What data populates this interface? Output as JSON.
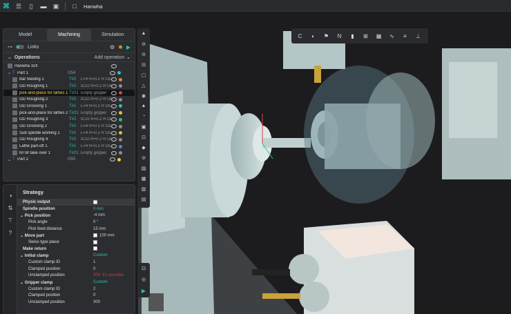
{
  "app": {
    "title": "Hanwha"
  },
  "tabs": [
    "Model",
    "Machining",
    "Simulation"
  ],
  "links": {
    "label": "Links"
  },
  "operations": {
    "header": "Operations",
    "add_label": "Add operation",
    "root_label": "Hanwha 32II",
    "part1": {
      "label": "Part 1",
      "code": "G54"
    },
    "part2": {
      "label": "Part 2",
      "code": "G55"
    },
    "rows": [
      {
        "name": "Bar feeding 1",
        "tool": "T#1",
        "tool_name": "L=4 R=0.2 R OD",
        "color": "#d98b2b"
      },
      {
        "name": "OD Roughing 1",
        "tool": "T#2",
        "tool_name": "IC10 R=0.2 R OD",
        "color": "#8f8f8f"
      },
      {
        "name": "pick-and-place for lathes 1",
        "tool": "T#21",
        "tool_name": "Empty gripper",
        "color": "#d24848"
      },
      {
        "name": "OD Roughing 2",
        "tool": "T#2",
        "tool_name": "IC10 R=0.2 R OD",
        "color": "#8f8f8f"
      },
      {
        "name": "OD Grooving 1",
        "tool": "T#1",
        "tool_name": "L=4 R=0.2 R OD",
        "color": "#27c2b0"
      },
      {
        "name": "pick-and-place for lathes 2",
        "tool": "T#21",
        "tool_name": "Empty gripper",
        "color": "#d9c52b"
      },
      {
        "name": "OD Roughing 3",
        "tool": "T#2",
        "tool_name": "IC10 R=0.2 R OD",
        "color": "#27c27a"
      },
      {
        "name": "OD Grooving 2",
        "tool": "T#1",
        "tool_name": "L=4 R=0.2 R OD",
        "color": "#8f8f8f"
      },
      {
        "name": "Sub spindle working 1",
        "tool": "T#1",
        "tool_name": "L=4 R=0.2 R OD",
        "color": "#d9c52b"
      },
      {
        "name": "OD Roughing 4",
        "tool": "T#2",
        "tool_name": "IC10 R=0.2 R OD",
        "color": "#8f8f8f"
      },
      {
        "name": "Lathe part-off 1",
        "tool": "T#1",
        "tool_name": "L=4 R=0.2 R OD",
        "color": "#3a8de0"
      },
      {
        "name": "MTM take over 1",
        "tool": "T#21",
        "tool_name": "Empty gripper",
        "color": "#8f8f8f"
      }
    ]
  },
  "strategy": {
    "title": "Strategy",
    "rows": [
      {
        "label": "Physic output",
        "value": "",
        "checkbox": true
      },
      {
        "label": "Spindle position",
        "value": "0 mm"
      },
      {
        "label": "Pick position",
        "value": "-4 mm"
      },
      {
        "label": "Pick angle",
        "value": "0 °"
      },
      {
        "label": "Pick feed distance",
        "value": "15 mm"
      },
      {
        "label": "Move part",
        "value": "100 mm",
        "checkbox": true
      },
      {
        "label": "Swiss type place",
        "value": "",
        "checkbox": true
      },
      {
        "label": "Make return",
        "value": "",
        "checkbox": true
      },
      {
        "label": "Initial clamp",
        "value": "Custom"
      },
      {
        "label": "Custom clamp ID",
        "value": "1"
      },
      {
        "label": "Clamped position",
        "value": "0"
      },
      {
        "label": "Unclamped position",
        "value": "300. It's possible"
      },
      {
        "label": "Gripper clamp",
        "value": "Custom"
      },
      {
        "label": "Custom clamp ID",
        "value": "2"
      },
      {
        "label": "Clamped position",
        "value": "0"
      },
      {
        "label": "Unclamped position",
        "value": "300"
      }
    ]
  },
  "colors": {
    "accent": "#27c2b0",
    "selected_text": "#ffd33d",
    "warning": "#e03838"
  }
}
